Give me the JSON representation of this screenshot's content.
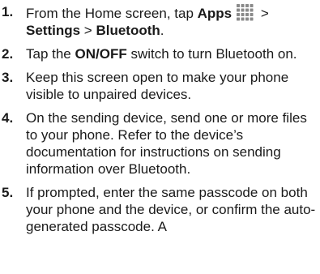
{
  "steps": [
    {
      "number": "1.",
      "line1_pre": "From the Home screen, tap ",
      "line1_bold": "Apps",
      "line1_post": " >",
      "line2_bold_a": "Settings",
      "line2_sep": " > ",
      "line2_bold_b": "Bluetooth",
      "line2_end": ".",
      "icon": "apps-grid-icon"
    },
    {
      "number": "2.",
      "pre": "Tap the ",
      "bold": "ON/OFF",
      "post": " switch to turn Bluetooth on."
    },
    {
      "number": "3.",
      "text": "Keep this screen open to make your phone visible to unpaired devices."
    },
    {
      "number": "4.",
      "text": "On the sending device, send one or more files to your phone. Refer to the device’s documentation for instructions on sending information over Bluetooth."
    },
    {
      "number": "5.",
      "text": "If prompted, enter the same passcode on both your phone and the device, or confirm the auto-generated passcode. A"
    }
  ]
}
